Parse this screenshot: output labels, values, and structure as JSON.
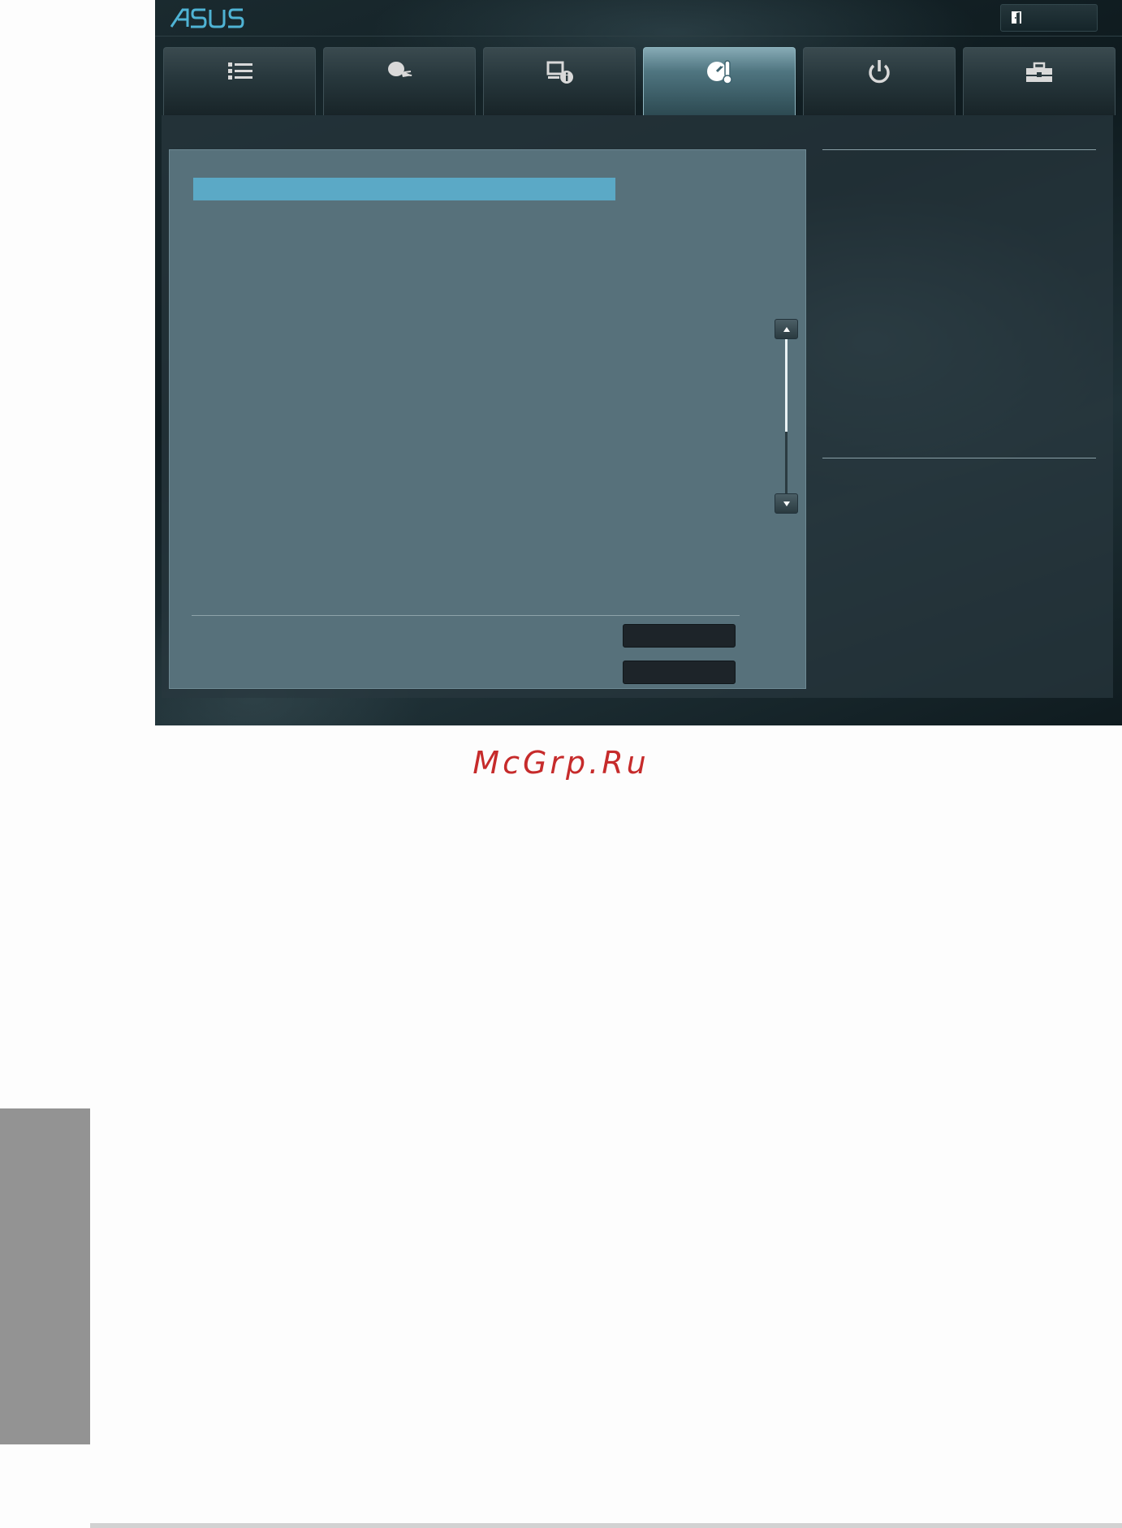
{
  "app": {
    "logo_text": "ASUS"
  },
  "header": {
    "exit_icon": "exit-door-icon"
  },
  "tabs": [
    {
      "icon": "main-menu-list-icon",
      "active": false
    },
    {
      "icon": "ai-tweaker-rocket-icon",
      "active": false
    },
    {
      "icon": "advanced-system-info-icon",
      "active": false
    },
    {
      "icon": "monitor-thermometer-icon",
      "active": true
    },
    {
      "icon": "boot-power-icon",
      "active": false
    },
    {
      "icon": "tool-toolbox-icon",
      "active": false
    }
  ],
  "colors": {
    "accent": "#5ba9c6",
    "panel": "#57717b",
    "watermark": "#c62b2b"
  },
  "scroll": {
    "position_fraction": 0.0,
    "visible_fraction": 0.6
  },
  "watermark": {
    "text": "McGrp.Ru"
  }
}
